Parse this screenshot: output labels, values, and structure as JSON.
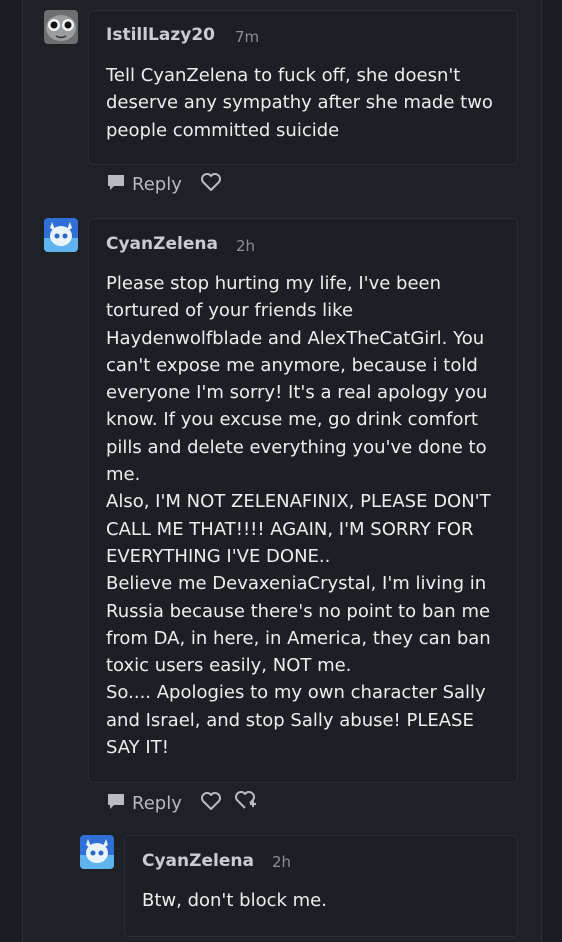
{
  "comments": [
    {
      "username": "IstillLazy20",
      "time": "7m",
      "text": "Tell CyanZelena to fuck off, she doesn't deserve any sympathy after she made two people committed suicide",
      "reply_label": "Reply"
    },
    {
      "username": "CyanZelena",
      "time": "2h",
      "text": "Please stop hurting my life, I've been tortured of your friends like Haydenwolfblade and AlexTheCatGirl. You can't expose me anymore, because i told everyone I'm sorry! It's a real apology you know. If you excuse me, go drink comfort pills and delete everything you've done to me.\nAlso, I'M NOT ZELENAFINIX, PLEASE DON'T CALL ME THAT!!!! AGAIN, I'M SORRY FOR EVERYTHING I'VE DONE..\nBelieve me DevaxeniaCrystal, I'm living in Russia because there's no point to ban me from DA, in here, in America, they can ban toxic users easily, NOT me.\nSo.... Apologies to my own character Sally and Israel, and stop Sally abuse! PLEASE SAY IT!",
      "reply_label": "Reply"
    },
    {
      "username": "CyanZelena",
      "time": "2h",
      "text": "Btw, don't block me."
    }
  ],
  "icons": {
    "reply": "speech-bubble-icon",
    "favourite": "heart-icon",
    "award": "heart-badge-icon"
  },
  "colors": {
    "background": "#1a1d21",
    "card": "#1c1f24",
    "text": "#eceef0",
    "muted": "#8a9097"
  }
}
